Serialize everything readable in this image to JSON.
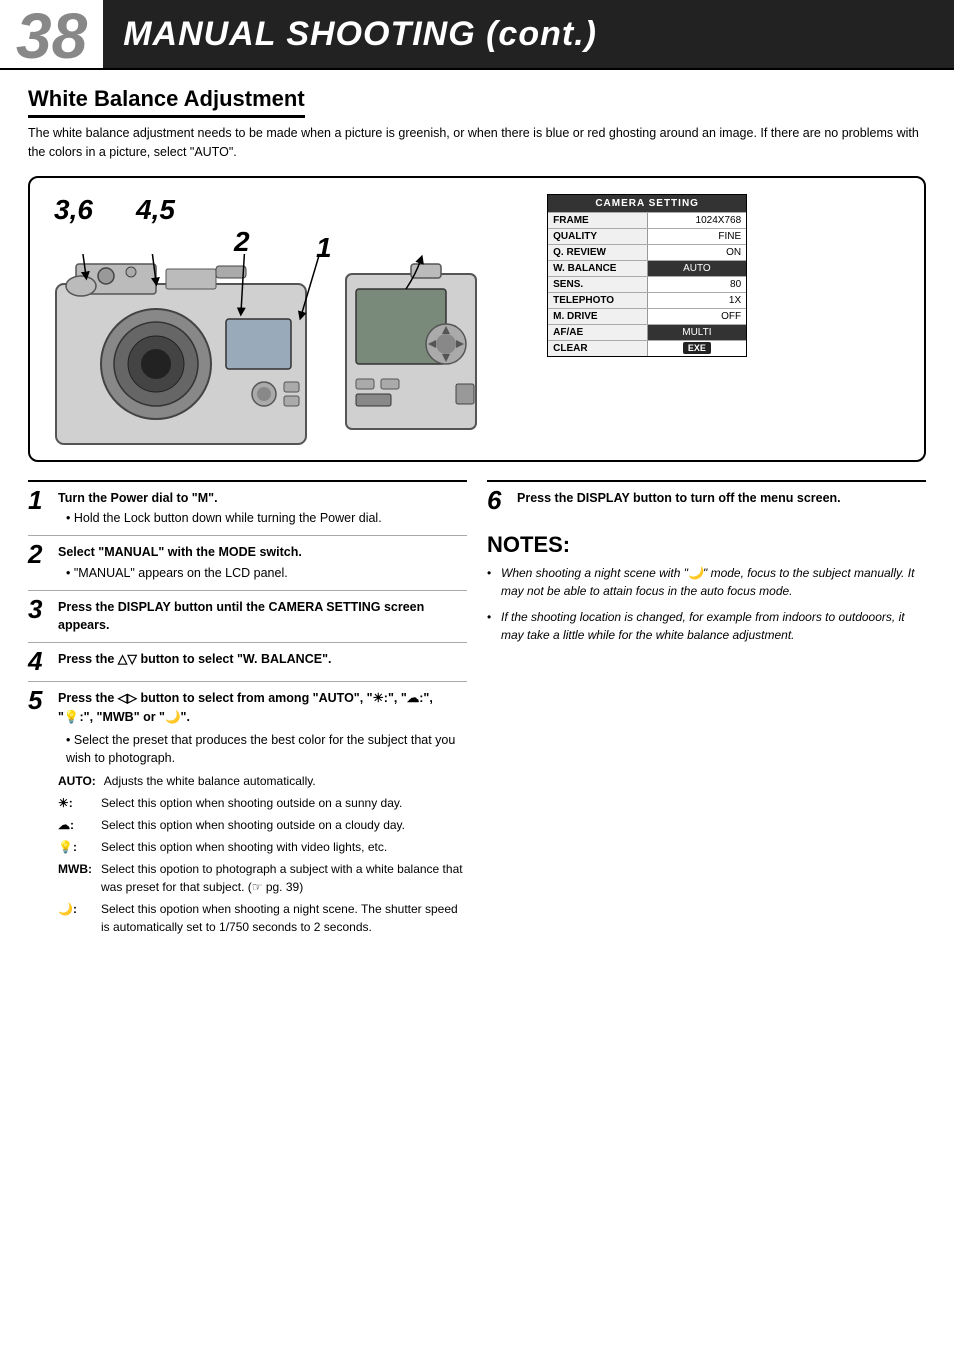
{
  "header": {
    "page_number": "38",
    "title": "MANUAL SHOOTING (cont.)"
  },
  "section": {
    "title": "White Balance Adjustment",
    "intro": "The white balance adjustment needs to be made when a picture is greenish, or when there is blue or red ghosting around an image. If there are no problems with the colors in a picture, select \"AUTO\"."
  },
  "diagram": {
    "step_labels": [
      "3,6",
      "4,5",
      "2",
      "1"
    ],
    "camera_settings": {
      "header": "CAMERA SETTING",
      "rows": [
        {
          "label": "FRAME",
          "value": "1024X768",
          "highlighted": false
        },
        {
          "label": "QUALITY",
          "value": "FINE",
          "highlighted": false
        },
        {
          "label": "Q. REVIEW",
          "value": "ON",
          "highlighted": false
        },
        {
          "label": "W. BALANCE",
          "value": "AUTO",
          "highlighted": true
        },
        {
          "label": "SENS.",
          "value": "80",
          "highlighted": false
        },
        {
          "label": "TELEPHOTO",
          "value": "1X",
          "highlighted": false
        },
        {
          "label": "M. DRIVE",
          "value": "OFF",
          "highlighted": false
        },
        {
          "label": "AF/AE",
          "value": "MULTI",
          "highlighted": false
        },
        {
          "label": "CLEAR",
          "value": "EXE",
          "highlighted": false,
          "is_exe": true
        }
      ]
    }
  },
  "steps": [
    {
      "num": "1",
      "main": "Turn the Power dial to \"M\".",
      "subs": [
        "Hold the Lock button down while turning the Power dial."
      ]
    },
    {
      "num": "2",
      "main": "Select \"MANUAL\" with the MODE switch.",
      "subs": [
        "\"MANUAL\" appears on the LCD panel."
      ]
    },
    {
      "num": "3",
      "main": "Press the DISPLAY button until the CAMERA SETTING screen appears.",
      "subs": []
    },
    {
      "num": "4",
      "main": "Press the △▽ button to select \"W. BALANCE\".",
      "subs": []
    },
    {
      "num": "5",
      "main": "Press the ◁▷ button to select from among \"AUTO\", \"☀:\", \"☁:\", \"💡:\", \"MWB\" or \"🌙\".",
      "subs": [],
      "options": [
        {
          "label": "AUTO:",
          "text": "Adjusts the white balance automatically."
        },
        {
          "label": "☀:",
          "text": "Select this option when shooting outside on a sunny day."
        },
        {
          "label": "☁:",
          "text": "Select this option when shooting outside on a cloudy day."
        },
        {
          "label": "💡:",
          "text": "Select this option when shooting with video lights, etc."
        },
        {
          "label": "MWB:",
          "text": "Select this opotion to photograph a subject with a white balance that was preset for that subject. (☞ pg. 39)"
        },
        {
          "label": "🌙:",
          "text": "Select this opotion when shooting a night scene. The shutter speed is automatically set to 1/750 seconds to 2 seconds."
        }
      ]
    }
  ],
  "step6": {
    "num": "6",
    "main": "Press the DISPLAY button to turn off the menu screen."
  },
  "notes": {
    "title": "NOTES:",
    "items": [
      "When shooting a night scene with \"🌙\" mode, focus to the subject manually. It may not be able to attain focus in the auto focus mode.",
      "If the shooting location is changed, for example from indoors to outdooors, it may take a little while for the white balance adjustment."
    ]
  }
}
